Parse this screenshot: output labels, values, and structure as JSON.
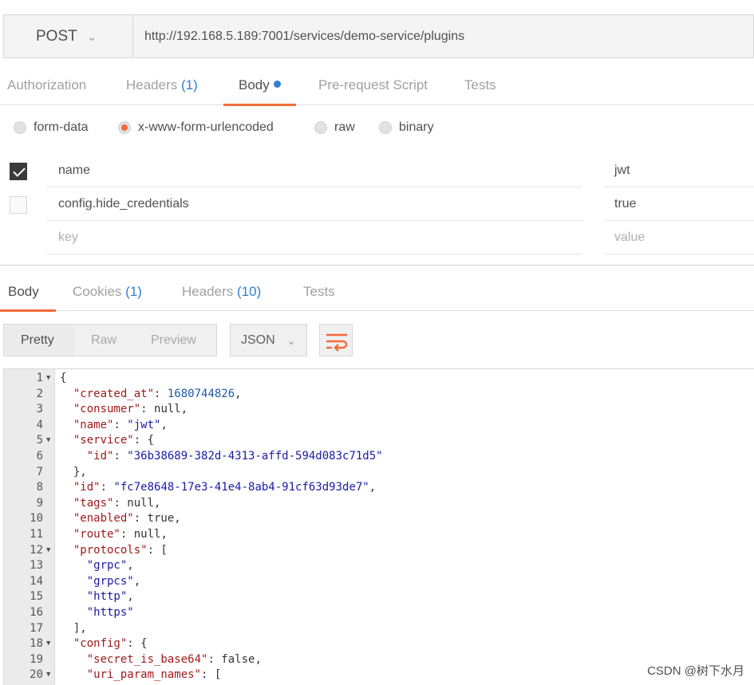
{
  "request": {
    "method": "POST",
    "url": "http://192.168.5.189:7001/services/demo-service/plugins",
    "tabs": {
      "authorization": "Authorization",
      "headers": "Headers",
      "headers_count": "(1)",
      "body": "Body",
      "prerequest": "Pre-request Script",
      "tests": "Tests"
    },
    "body_types": {
      "form_data": "form-data",
      "urlencoded": "x-www-form-urlencoded",
      "raw": "raw",
      "binary": "binary"
    },
    "params": [
      {
        "key": "name",
        "value": "jwt"
      },
      {
        "key": "config.hide_credentials",
        "value": "true"
      },
      {
        "key": "key",
        "value": "value"
      }
    ]
  },
  "response": {
    "tabs": {
      "body": "Body",
      "cookies": "Cookies",
      "cookies_count": "(1)",
      "headers": "Headers",
      "headers_count": "(10)",
      "tests": "Tests"
    },
    "views": {
      "pretty": "Pretty",
      "raw": "Raw",
      "preview": "Preview"
    },
    "format": "JSON",
    "lines": [
      {
        "n": "1",
        "t": "{"
      },
      {
        "n": "2",
        "t": "  \"created_at\": 1680744826,"
      },
      {
        "n": "3",
        "t": "  \"consumer\": null,"
      },
      {
        "n": "4",
        "t": "  \"name\": \"jwt\","
      },
      {
        "n": "5",
        "t": "  \"service\": {"
      },
      {
        "n": "6",
        "t": "    \"id\": \"36b38689-382d-4313-affd-594d083c71d5\""
      },
      {
        "n": "7",
        "t": "  },"
      },
      {
        "n": "8",
        "t": "  \"id\": \"fc7e8648-17e3-41e4-8ab4-91cf63d93de7\","
      },
      {
        "n": "9",
        "t": "  \"tags\": null,"
      },
      {
        "n": "10",
        "t": "  \"enabled\": true,"
      },
      {
        "n": "11",
        "t": "  \"route\": null,"
      },
      {
        "n": "12",
        "t": "  \"protocols\": ["
      },
      {
        "n": "13",
        "t": "    \"grpc\","
      },
      {
        "n": "14",
        "t": "    \"grpcs\","
      },
      {
        "n": "15",
        "t": "    \"http\","
      },
      {
        "n": "16",
        "t": "    \"https\""
      },
      {
        "n": "17",
        "t": "  ],"
      },
      {
        "n": "18",
        "t": "  \"config\": {"
      },
      {
        "n": "19",
        "t": "    \"secret_is_base64\": false,"
      },
      {
        "n": "20",
        "t": "    \"uri_param_names\": ["
      }
    ],
    "fold_lines": [
      "1",
      "5",
      "12",
      "18",
      "20"
    ]
  },
  "watermark": "CSDN @树下水月"
}
